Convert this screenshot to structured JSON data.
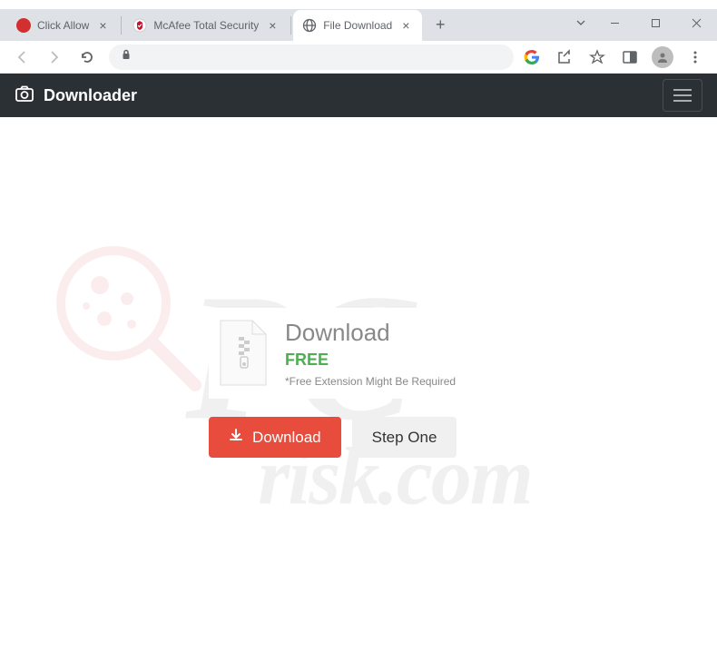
{
  "tabs": [
    {
      "title": "Click Allow",
      "favicon_color": "#d32f2f",
      "active": false
    },
    {
      "title": "McAfee Total Security",
      "favicon_type": "mcafee",
      "active": false
    },
    {
      "title": "File Download",
      "favicon_type": "globe",
      "active": true
    }
  ],
  "page": {
    "brand": "Downloader",
    "download_heading": "Download",
    "free_label": "FREE",
    "note": "*Free Extension Might Be Required",
    "download_button": "Download",
    "step_button": "Step One"
  },
  "watermark": {
    "line1": "PC",
    "line2": "risk.com"
  }
}
